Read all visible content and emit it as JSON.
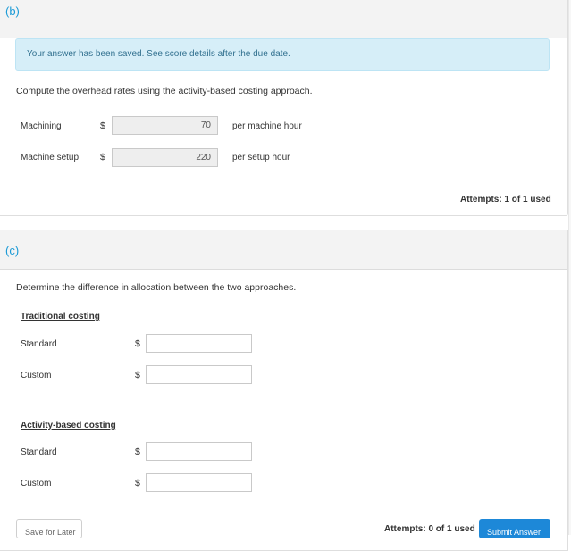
{
  "part_b": {
    "label": "(b)",
    "notice": "Your answer has been saved. See score details after the due date.",
    "prompt": "Compute the overhead rates using the activity-based costing approach.",
    "rows": [
      {
        "label": "Machining",
        "currency": "$",
        "value": "70",
        "unit": "per machine hour"
      },
      {
        "label": "Machine setup",
        "currency": "$",
        "value": "220",
        "unit": "per setup hour"
      }
    ],
    "attempts": "Attempts: 1 of 1 used"
  },
  "part_c": {
    "label": "(c)",
    "prompt": "Determine the difference in allocation between the two approaches.",
    "groups": [
      {
        "heading": "Traditional costing",
        "rows": [
          {
            "label": "Standard",
            "currency": "$",
            "value": ""
          },
          {
            "label": "Custom",
            "currency": "$",
            "value": ""
          }
        ]
      },
      {
        "heading": "Activity-based costing",
        "rows": [
          {
            "label": "Standard",
            "currency": "$",
            "value": ""
          },
          {
            "label": "Custom",
            "currency": "$",
            "value": ""
          }
        ]
      }
    ],
    "attempts": "Attempts: 0 of 1 used",
    "save_label": "Save for Later",
    "submit_label": "Submit Answer"
  },
  "colors": {
    "part_label": "#1a9ad6",
    "notice_bg": "#d6eef8",
    "notice_text": "#31708f",
    "submit_bg": "#1d88d8"
  }
}
